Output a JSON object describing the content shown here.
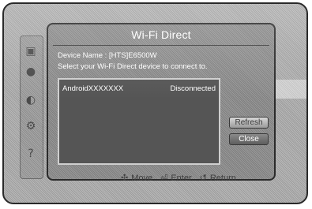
{
  "dialog": {
    "title": "Wi-Fi Direct",
    "device_name_line": "Device Name : [HTS]E6500W",
    "instruction": "Select your Wi-Fi Direct device to connect to.",
    "devices": [
      {
        "name": "AndroidXXXXXXX",
        "status": "Disconnected"
      }
    ],
    "buttons": {
      "refresh": "Refresh",
      "close": "Close"
    }
  },
  "hints": {
    "move": "Move",
    "enter": "Enter",
    "return": "Return"
  },
  "icons": {
    "move": "dpad-icon",
    "enter": "enter-icon",
    "return": "return-icon"
  }
}
